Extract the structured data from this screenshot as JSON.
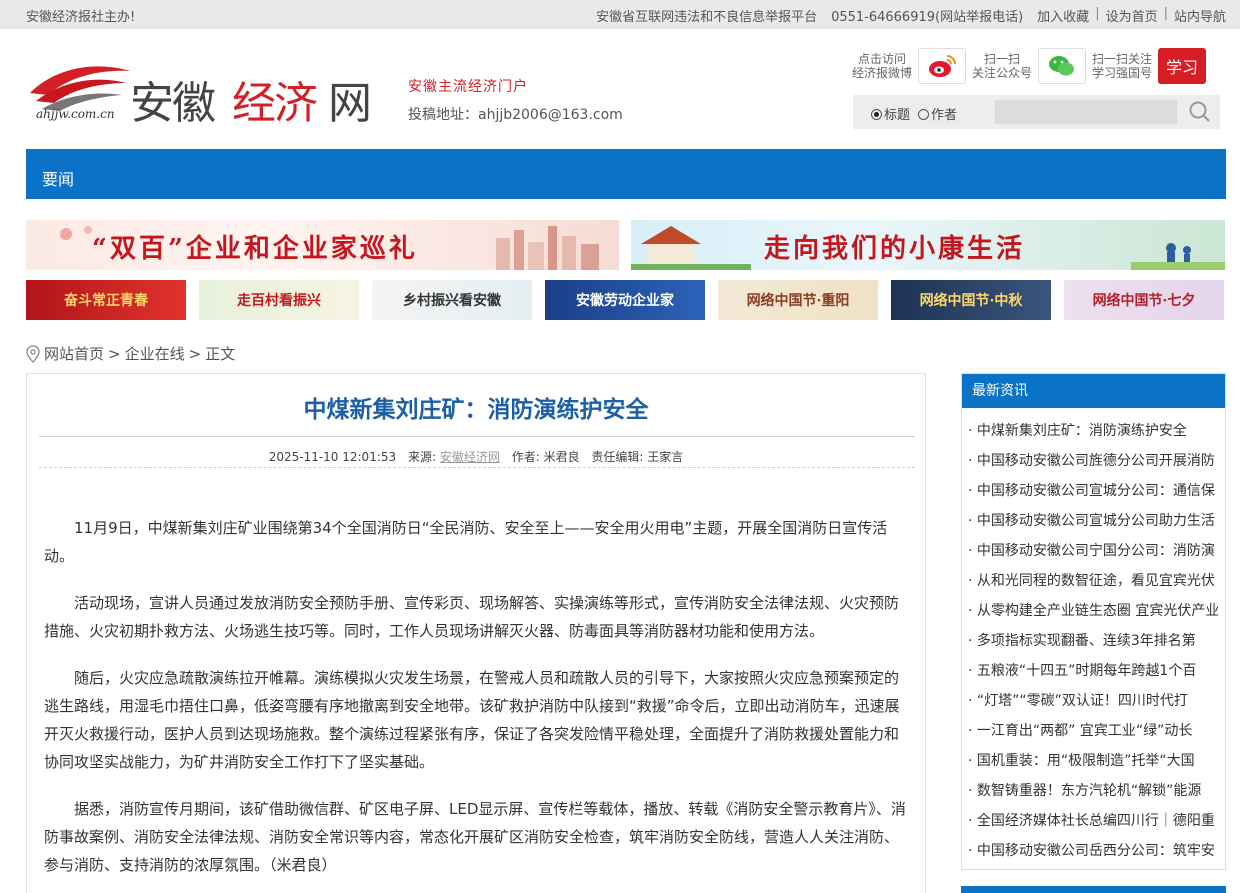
{
  "topbar": {
    "left_text": "安徽经济报社主办!",
    "platform": "安徽省互联网违法和不良信息举报平台",
    "hotline": "0551-64666919(网站举报电话)",
    "links": [
      "加入收藏",
      "设为首页",
      "站内导航"
    ]
  },
  "header": {
    "logo_domain": "ahjjw.com.cn",
    "logo_name_a": "安徽",
    "logo_name_b": "经济",
    "logo_name_c": "网",
    "slogan": "安徽主流经济门户",
    "contribute": "投稿地址：ahjjb2006@163.com",
    "social": {
      "weibo_label_1": "点击访问",
      "weibo_label_2": "经济报微博",
      "wechat_label_1": "扫一扫",
      "wechat_label_2": "关注公众号",
      "xuexi_label_1": "扫一扫关注",
      "xuexi_label_2": "学习强国号",
      "xuexi_badge": "学习"
    },
    "search": {
      "option_title": "标题",
      "option_author": "作者",
      "selected": "标题",
      "placeholder": ""
    }
  },
  "nav": {
    "items": [
      "要闻"
    ]
  },
  "banners": {
    "big": [
      "“双百”企业和企业家巡礼",
      "走向我们的小康生活"
    ],
    "small": [
      "奋斗常正青春",
      "走百村看振兴",
      "乡村振兴看安徽",
      "安徽劳动企业家",
      "网络中国节·重阳",
      "网络中国节·中秋",
      "网络中国节·七夕"
    ]
  },
  "breadcrumb": {
    "items": [
      "网站首页",
      "企业在线",
      "正文"
    ],
    "separator": ">"
  },
  "article": {
    "title": "中煤新集刘庄矿：消防演练护安全",
    "datetime": "2025-11-10 12:01:53",
    "source_label": "来源:",
    "source": "安徽经济网",
    "author_label": "作者:",
    "author": "米君良",
    "editor_label": "责任编辑:",
    "editor": "王家言",
    "paragraphs": [
      "11月9日，中煤新集刘庄矿业围绕第34个全国消防日“全民消防、安全至上——安全用火用电”主题，开展全国消防日宣传活动。",
      "活动现场，宣讲人员通过发放消防安全预防手册、宣传彩页、现场解答、实操演练等形式，宣传消防安全法律法规、火灾预防措施、火灾初期扑救方法、火场逃生技巧等。同时，工作人员现场讲解灭火器、防毒面具等消防器材功能和使用方法。",
      "随后，火灾应急疏散演练拉开帷幕。演练模拟火灾发生场景，在警戒人员和疏散人员的引导下，大家按照火灾应急预案预定的逃生路线，用湿毛巾捂住口鼻，低姿弯腰有序地撤离到安全地带。该矿救护消防中队接到“救援”命令后，立即出动消防车，迅速展开灭火救援行动，医护人员到达现场施救。整个演练过程紧张有序，保证了各突发险情平稳处理，全面提升了消防救援处置能力和协同攻坚实战能力，为矿井消防安全工作打下了坚实基础。",
      "据悉，消防宣传月期间，该矿借助微信群、矿区电子屏、LED显示屏、宣传栏等载体，播放、转载《消防安全警示教育片》、消防事故案例、消防安全法律法规、消防安全常识等内容，常态化开展矿区消防安全检查，筑牢消防安全防线，营造人人关注消防、参与消防、支持消防的浓厚氛围。（米君良）"
    ]
  },
  "sidebar": {
    "heading": "最新资讯",
    "items": [
      "· 中煤新集刘庄矿：消防演练护安全",
      "· 中国移动安徽公司旌德分公司开展消防",
      "· 中国移动安徽公司宣城分公司：通信保",
      "· 中国移动安徽公司宣城分公司助力生活",
      "· 中国移动安徽公司宁国分公司：消防演",
      "· 从和光同程的数智征途，看见宜宾光伏",
      "· 从零构建全产业链生态圈 宜宾光伏产业",
      "· 多项指标实现翻番、连续3年排名第",
      "· 五粮液“十四五”时期每年跨越1个百",
      "· “灯塔”“零碳”双认证！四川时代打",
      "· 一江育出“两都” 宜宾工业“绿”动长",
      "· 国机重装：用“极限制造”托举“大国",
      "· 数智铸重器！东方汽轮机“解锁”能源",
      "· 全国经济媒体社长总编四川行｜德阳重",
      "· 中国移动安徽公司岳西分公司：筑牢安"
    ]
  },
  "colors": {
    "brand_blue": "#0a72c7",
    "title_blue": "#1b5fa8",
    "brand_red": "#d32027"
  }
}
